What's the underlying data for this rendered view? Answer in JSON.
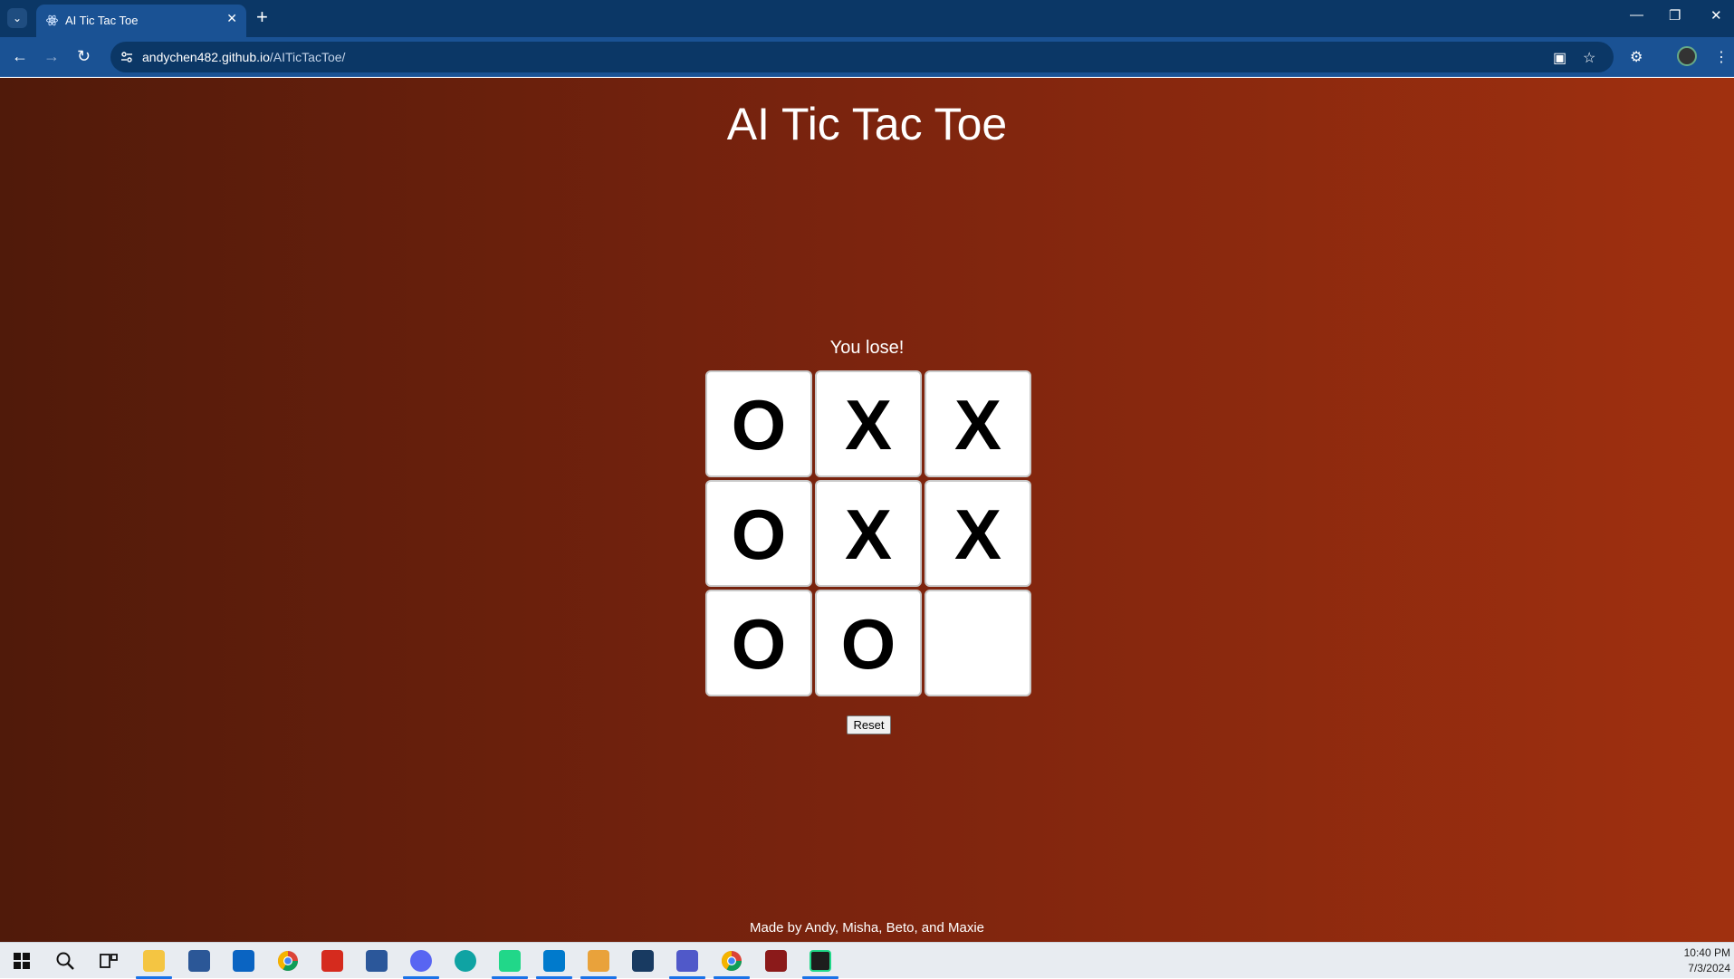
{
  "browser": {
    "tab_title": "AI Tic Tac Toe",
    "url_domain": "andychen482.github.io",
    "url_path": "/AITicTacToe/"
  },
  "page": {
    "title": "AI Tic Tac Toe",
    "status": "You lose!",
    "board": [
      [
        "O",
        "X",
        "X"
      ],
      [
        "O",
        "X",
        "X"
      ],
      [
        "O",
        "O",
        ""
      ]
    ],
    "reset_label": "Reset",
    "credits": "Made by Andy, Misha, Beto, and Maxie"
  },
  "taskbar": {
    "apps": [
      "start-icon",
      "search-icon",
      "task-view-icon",
      "file-explorer-icon",
      "store-icon",
      "mail-icon",
      "chrome-icon",
      "app-red-icon",
      "word-icon",
      "discord-icon",
      "edge-icon",
      "clion-icon",
      "vscode-icon",
      "git-icon",
      "virtualbox-icon",
      "teams-icon",
      "chrome-active-icon",
      "winrar-icon",
      "pycharm-icon"
    ],
    "time": "10:40 PM",
    "date": "7/3/2024"
  },
  "colors": {
    "chrome_dark": "#0b3766",
    "chrome_toolbar": "#1a5294",
    "page_gradient_left": "#501a0a",
    "page_gradient_right": "#a0300f"
  }
}
